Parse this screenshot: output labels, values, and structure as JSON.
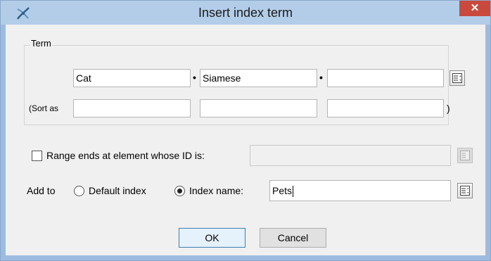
{
  "window": {
    "title": "Insert index term",
    "close_symbol": "✕",
    "app_icon": "oxygen-logo-icon"
  },
  "term_group": {
    "legend": "Term",
    "separator": "•",
    "primary": "Cat",
    "secondary": "Siamese",
    "tertiary": "",
    "sort_as_label": "(Sort as",
    "sort_primary": "",
    "sort_secondary": "",
    "sort_tertiary": "",
    "closing_paren": ")",
    "picker_icon": "list-picker-icon"
  },
  "range": {
    "label": "Range ends at element whose ID is:",
    "checked": false,
    "value": ""
  },
  "add_to": {
    "label": "Add to",
    "default_index_label": "Default index",
    "index_name_label": "Index name:",
    "selected": "index_name",
    "index_name_value": "Pets"
  },
  "buttons": {
    "ok": "OK",
    "cancel": "Cancel"
  },
  "colors": {
    "title_bar": "#b3cde9",
    "close_button": "#c94a3d",
    "dialog_bg": "#f0f0f0",
    "default_button_border": "#3c7fb1"
  }
}
